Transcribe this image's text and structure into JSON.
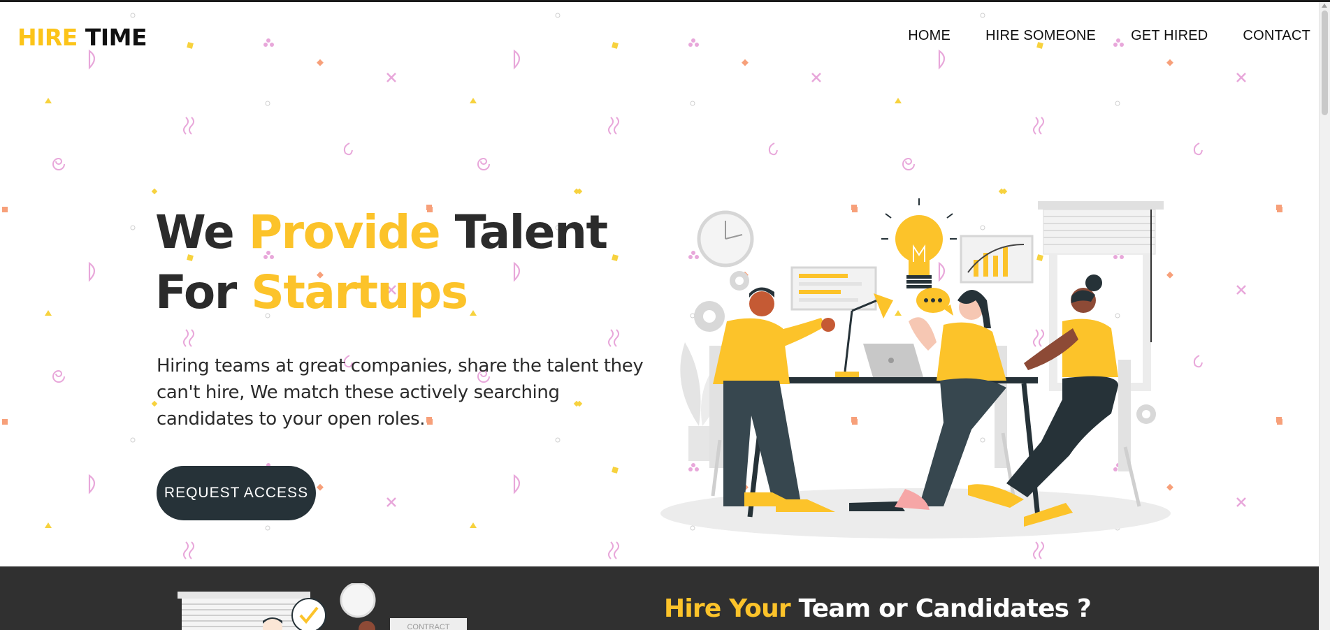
{
  "header": {
    "logo_accent": "HIRE",
    "logo_dark": "TIME",
    "nav": [
      {
        "label": "HOME"
      },
      {
        "label": "HIRE SOMEONE"
      },
      {
        "label": "GET HIRED"
      },
      {
        "label": "CONTACT"
      }
    ]
  },
  "hero": {
    "title_part1": "We ",
    "title_highlight1": "Provide",
    "title_part2": " Talent For ",
    "title_highlight2": "Startups",
    "description": "Hiring teams at great companies, share the talent they can't hire, We match these actively searching candidates to your open roles.",
    "cta_label": "REQUEST ACCESS"
  },
  "section2": {
    "title_highlight": "Hire Your",
    "title_rest": " Team or Candidates ?",
    "contract_label": "CONTRACT"
  },
  "colors": {
    "accent": "#fcc419",
    "dark": "#263238",
    "band": "#303030",
    "pattern_pink": "#e8a7da",
    "pattern_yellow": "#f7d23e",
    "pattern_orange": "#f7a07a"
  },
  "icons": [
    "clock-icon",
    "lightbulb-icon",
    "gear-icon",
    "chat-bubble-icon",
    "laptop-icon",
    "lamp-icon",
    "plant-icon",
    "bar-chart-icon",
    "window-blind-icon",
    "checkmark-icon"
  ]
}
